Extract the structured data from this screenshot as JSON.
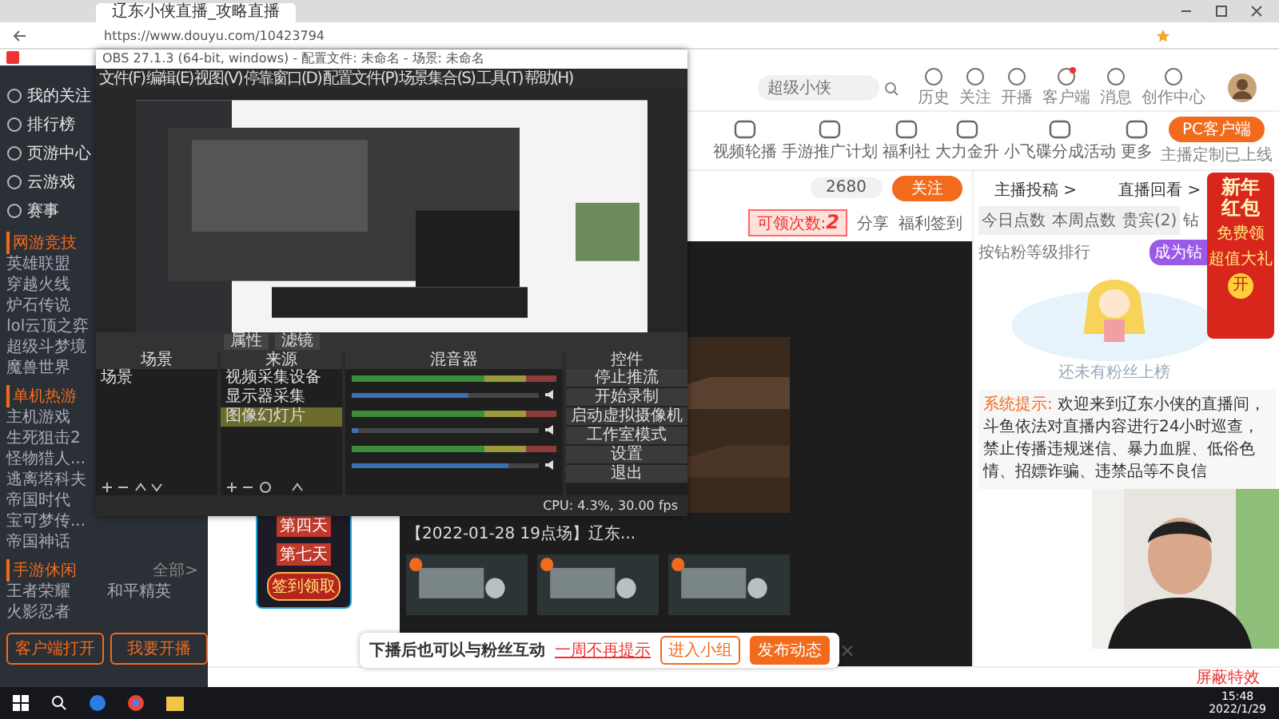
{
  "browser": {
    "tab_title": "辽东小侠直播_攻略直播",
    "url": "https://www.douyu.com/10423794"
  },
  "sidebar": {
    "nav": [
      "我的关注",
      "排行榜",
      "页游中心",
      "云游戏",
      "赛事"
    ],
    "sections": [
      {
        "title": "网游竞技",
        "items": [
          "英雄联盟",
          "穿越火线",
          "炉石传说",
          "lol云顶之弈",
          "超级斗梦境",
          "魔兽世界"
        ]
      },
      {
        "title": "单机热游",
        "items": [
          "主机游戏",
          "生死狙击2",
          "怪物猎人...",
          "逃离塔科夫",
          "帝国时代",
          "宝可梦传...",
          "帝国神话"
        ]
      },
      {
        "title": "手游休闲",
        "more": "全部>",
        "items": [
          "王者荣耀",
          "和平精英",
          "火影忍者"
        ]
      }
    ],
    "buttons": [
      "客户端打开",
      "我要开播"
    ]
  },
  "header": {
    "search_placeholder": "超级小侠",
    "icons": [
      "历史",
      "关注",
      "开播",
      "客户端",
      "消息",
      "创作中心"
    ]
  },
  "nav": {
    "items": [
      "视频轮播",
      "手游推广计划",
      "福利社",
      "大力金升",
      "小飞碟分成活动",
      "更多"
    ],
    "pc_button": "PC客户端",
    "pc_note": "主播定制已上线"
  },
  "player": {
    "followers": "2680",
    "follow": "关注",
    "claims_label": "可领次数:",
    "claims": "2",
    "share": "分享",
    "checkin": "福利签到",
    "title": "【2022-01-28 19点场】辽东..."
  },
  "banner": {
    "days": [
      "第四天",
      "第七天"
    ],
    "button": "签到领取"
  },
  "panel": {
    "links": [
      "主播投稿 >",
      "直播回看 >"
    ],
    "tabs": [
      {
        "label": "今日点数",
        "selected": false
      },
      {
        "label": "本周点数",
        "selected": false
      },
      {
        "label": "贵宾(2)",
        "selected": false
      },
      {
        "label": "钻",
        "selected": true
      }
    ],
    "rank_note": "按钻粉等级排行",
    "become": "成为钻",
    "empty": "还未有粉丝上榜",
    "notice": {
      "label": "系统提示:",
      "text": "欢迎来到辽东小侠的直播间，斗鱼依法对直播内容进行24小时巡查，禁止传播违规迷信、暴力血腥、低俗色情、招嫖诈骗、违禁品等不良信"
    }
  },
  "red_packet": {
    "title": "新年红包",
    "line1": "免费领",
    "line2": "超值大礼",
    "open": "开"
  },
  "popup": {
    "message": "下播后也可以与粉丝互动",
    "link": "一周不再提示",
    "secondary": "进入小组",
    "primary": "发布动态",
    "close": "×"
  },
  "status_bar": {
    "effects": "屏蔽特效"
  },
  "obs": {
    "title": "OBS 27.1.3 (64-bit, windows) - 配置文件: 未命名 - 场景: 未命名",
    "menu": [
      "文件(F)",
      "编辑(E)",
      "视图(V)",
      "停靠窗口(D)",
      "配置文件(P)",
      "场景集合(S)",
      "工具(T)",
      "帮助(H)"
    ],
    "toolbar": [
      "属性",
      "滤镜"
    ],
    "docks": [
      "场景",
      "来源",
      "混音器",
      "控件"
    ],
    "scenes": [
      {
        "name": "场景",
        "selected": false
      }
    ],
    "sources": [
      {
        "name": "视频采集设备",
        "selected": false
      },
      {
        "name": "显示器采集",
        "selected": false
      },
      {
        "name": "图像幻灯片",
        "selected": true
      }
    ],
    "mixer": [
      {
        "level": 0.62
      },
      {
        "level": 0.03
      },
      {
        "level": 0.84
      }
    ],
    "controls": [
      "停止推流",
      "开始录制",
      "启动虚拟摄像机",
      "工作室模式",
      "设置",
      "退出"
    ],
    "status": "CPU: 4.3%, 30.00 fps"
  },
  "taskbar": {
    "time": "15:48",
    "date": "2022/1/29"
  }
}
